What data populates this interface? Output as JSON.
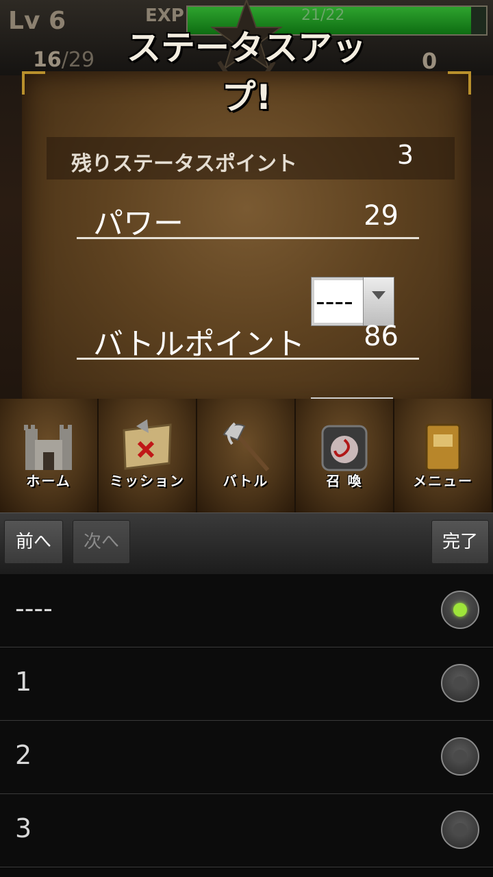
{
  "header": {
    "level": "Lv 6",
    "exp_label": "EXP",
    "exp_text": "21/22",
    "exp_progress": 0.95,
    "stamina_current": "16",
    "stamina_max": "/29",
    "right_value": "0"
  },
  "dialog": {
    "title": "ステータスアップ!",
    "remaining_label": "残りステータスポイント",
    "remaining_value": "3",
    "stats": [
      {
        "label": "パワー",
        "value": "29",
        "select_value": "----"
      },
      {
        "label": "バトルポイント",
        "value": "86"
      }
    ]
  },
  "menu": [
    {
      "label": "ホーム",
      "icon": "castle-icon"
    },
    {
      "label": "ミッション",
      "icon": "map-icon"
    },
    {
      "label": "バトル",
      "icon": "axe-icon"
    },
    {
      "label": "召 喚",
      "icon": "portal-icon"
    },
    {
      "label": "メニュー",
      "icon": "book-icon"
    }
  ],
  "picker": {
    "prev_label": "前へ",
    "next_label": "次へ",
    "done_label": "完了",
    "options": [
      "----",
      "1",
      "2",
      "3"
    ],
    "selected_index": 0
  }
}
